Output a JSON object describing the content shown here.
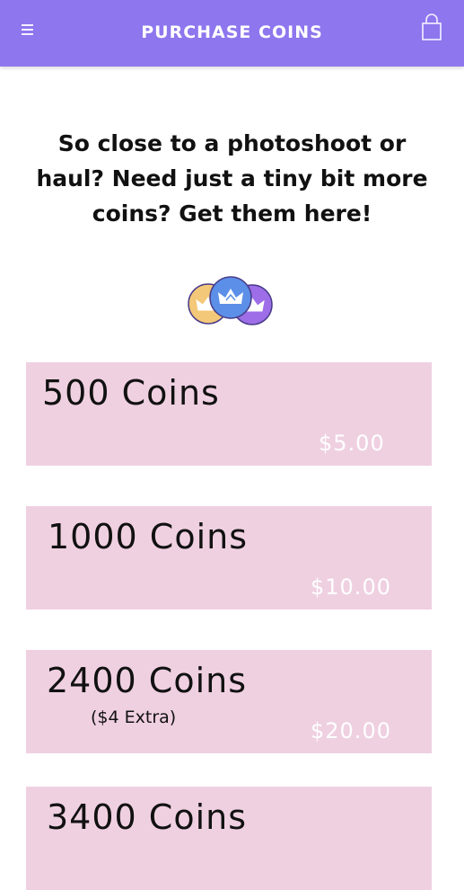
{
  "header": {
    "title": "PURCHASE COINS",
    "menu_icon": "hamburger-menu-icon",
    "cart_icon": "shopping-bag-icon",
    "background": "#8d76ee"
  },
  "intro": {
    "text": "So close to a photoshoot or haul? Need just a tiny bit more coins? Get them here!"
  },
  "coins_graphic": {
    "icon": "crown-coins-icon",
    "colors": [
      "#f3c878",
      "#5b8fe8",
      "#9d6ee8"
    ]
  },
  "packages": [
    {
      "name": "500 Coins",
      "extra": "",
      "price": "$5.00"
    },
    {
      "name": "1000 Coins",
      "extra": "",
      "price": "$10.00"
    },
    {
      "name": "2400 Coins",
      "extra": "($4 Extra)",
      "price": "$20.00"
    },
    {
      "name": "3400 Coins",
      "extra": "",
      "price": ""
    }
  ],
  "colors": {
    "card": "#efd0e1",
    "price_text": "#ffffff"
  }
}
